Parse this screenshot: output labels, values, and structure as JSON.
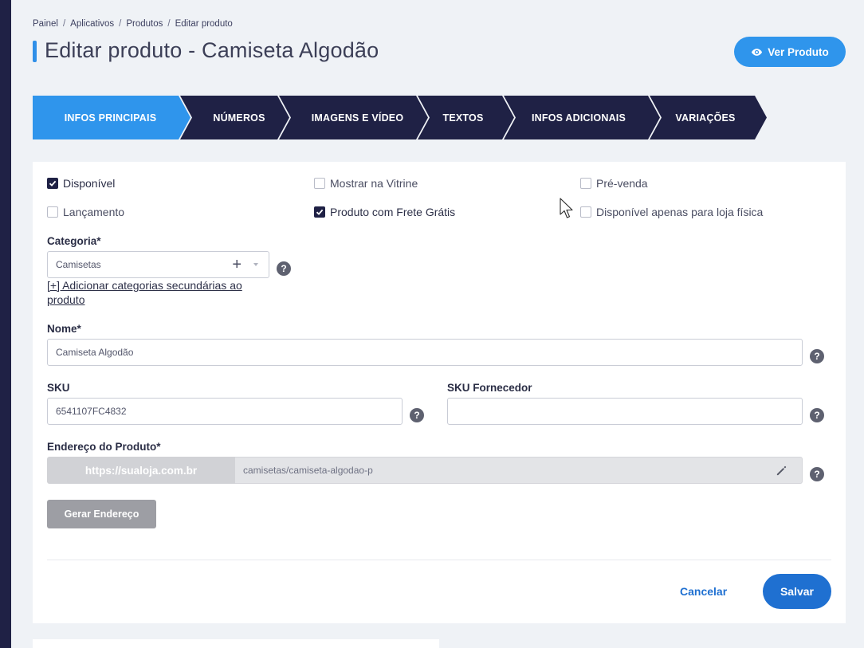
{
  "breadcrumb": [
    "Painel",
    "Aplicativos",
    "Produtos",
    "Editar produto"
  ],
  "page": {
    "title": "Editar produto - Camiseta Algodão"
  },
  "header": {
    "view_button": "Ver Produto",
    "view_icon": "eye-icon"
  },
  "tabs": [
    {
      "label": "INFOS PRINCIPAIS",
      "active": true
    },
    {
      "label": "NÚMEROS",
      "active": false
    },
    {
      "label": "IMAGENS E VÍDEO",
      "active": false
    },
    {
      "label": "TEXTOS",
      "active": false
    },
    {
      "label": "INFOS ADICIONAIS",
      "active": false
    },
    {
      "label": "VARIAÇÕES",
      "active": false
    }
  ],
  "colors": {
    "active_tab": "#2f95ec",
    "inactive_tab": "#1f2145",
    "primary": "#1f70d1"
  },
  "checkboxes": {
    "disponivel": {
      "label": "Disponível",
      "checked": true
    },
    "vitrine": {
      "label": "Mostrar na Vitrine",
      "checked": false
    },
    "prevenda": {
      "label": "Pré-venda",
      "checked": false
    },
    "lancamento": {
      "label": "Lançamento",
      "checked": false
    },
    "frete": {
      "label": "Produto com Frete Grátis",
      "checked": true
    },
    "loja_fisica": {
      "label": "Disponível apenas para loja física",
      "checked": false
    }
  },
  "categoria": {
    "label": "Categoria*",
    "value": "Camisetas",
    "add_link": "[+] Adicionar categorias secundárias ao produto"
  },
  "nome": {
    "label": "Nome*",
    "value": "Camiseta Algodão"
  },
  "sku": {
    "label": "SKU",
    "value": "6541107FC4832"
  },
  "sku_fornecedor": {
    "label": "SKU Fornecedor",
    "value": ""
  },
  "endereco": {
    "label": "Endereço do Produto*",
    "prefix": "https://sualoja.com.br",
    "value": "camisetas/camiseta-algodao-p",
    "generate_button": "Gerar Endereço"
  },
  "help_glyph": "?",
  "actions": {
    "cancel": "Cancelar",
    "save": "Salvar"
  }
}
